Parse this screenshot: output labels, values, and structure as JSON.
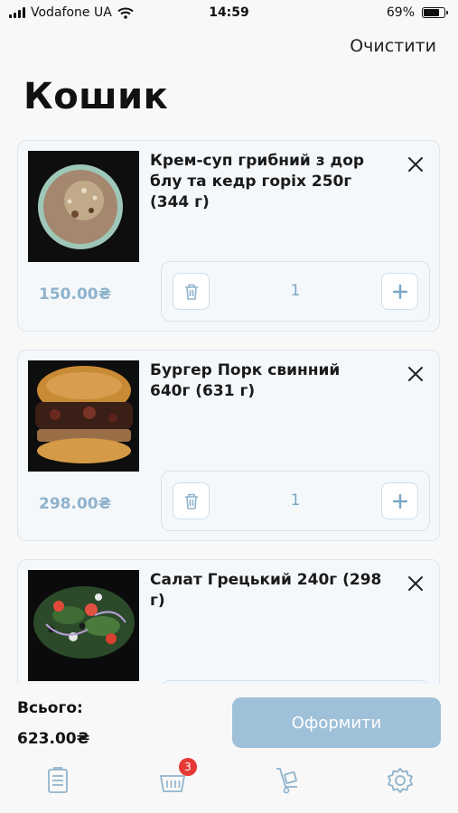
{
  "status_bar": {
    "carrier": "Vodafone UA",
    "time": "14:59",
    "battery": "69%",
    "battery_level": 0.69
  },
  "header": {
    "clear_label": "Очистити",
    "title": "Кошик"
  },
  "cart": {
    "items": [
      {
        "name": "Крем-суп грибний з дор блу та кедр горіх 250г (344 г)",
        "price": "150.00₴",
        "quantity": "1"
      },
      {
        "name": "Бургер Порк свинний 640г (631 г)",
        "price": "298.00₴",
        "quantity": "1"
      },
      {
        "name": "Салат Грецький 240г (298 г)",
        "price": "",
        "quantity": ""
      }
    ]
  },
  "footer": {
    "total_label": "Всього:",
    "total_value": "623.00₴",
    "checkout_label": "Оформити"
  },
  "tabbar": {
    "cart_badge": "3",
    "icons": [
      "menu-icon",
      "cart-icon",
      "delivery-icon",
      "settings-icon"
    ]
  },
  "colors": {
    "accent": "#9ec0d8",
    "price": "#8fb3cc",
    "badge": "#e53935"
  }
}
